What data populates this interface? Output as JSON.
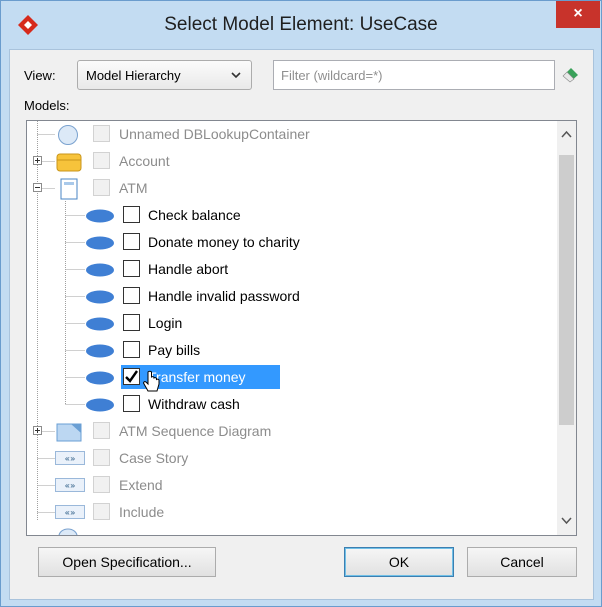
{
  "window": {
    "title": "Select Model Element: UseCase",
    "close_label": "×"
  },
  "view": {
    "label": "View:",
    "selected": "Model Hierarchy"
  },
  "filter": {
    "placeholder": "Filter (wildcard=*)",
    "value": ""
  },
  "models_label": "Models:",
  "tree": {
    "rows": [
      {
        "label": "Unnamed DBLookupContainer",
        "icon": "container-icon",
        "checkbox": "disabled",
        "expander": "",
        "level": 0
      },
      {
        "label": "Account",
        "icon": "class-icon",
        "checkbox": "disabled",
        "expander": "+",
        "level": 0
      },
      {
        "label": "ATM",
        "icon": "system-icon",
        "checkbox": "disabled",
        "expander": "-",
        "level": 0
      },
      {
        "label": "Check balance",
        "icon": "usecase-icon",
        "checkbox": "unchecked",
        "level": 1
      },
      {
        "label": "Donate money to charity",
        "icon": "usecase-icon",
        "checkbox": "unchecked",
        "level": 1
      },
      {
        "label": "Handle abort",
        "icon": "usecase-icon",
        "checkbox": "unchecked",
        "level": 1
      },
      {
        "label": "Handle invalid password",
        "icon": "usecase-icon",
        "checkbox": "unchecked",
        "level": 1
      },
      {
        "label": "Login",
        "icon": "usecase-icon",
        "checkbox": "unchecked",
        "level": 1
      },
      {
        "label": "Pay bills",
        "icon": "usecase-icon",
        "checkbox": "unchecked",
        "level": 1
      },
      {
        "label": "Transfer money",
        "icon": "usecase-icon",
        "checkbox": "checked",
        "level": 1,
        "selected": true
      },
      {
        "label": "Withdraw cash",
        "icon": "usecase-icon",
        "checkbox": "unchecked",
        "level": 1
      },
      {
        "label": "ATM Sequence Diagram",
        "icon": "diagram-icon",
        "checkbox": "disabled",
        "expander": "+",
        "level": 0
      },
      {
        "label": "Case Story",
        "icon": "stereotype-icon",
        "checkbox": "disabled",
        "level": 0
      },
      {
        "label": "Extend",
        "icon": "stereotype-icon",
        "checkbox": "disabled",
        "level": 0
      },
      {
        "label": "Include",
        "icon": "stereotype-icon",
        "checkbox": "disabled",
        "level": 0
      }
    ]
  },
  "buttons": {
    "open_spec": "Open Specification...",
    "ok": "OK",
    "cancel": "Cancel"
  },
  "colors": {
    "selection": "#3399ff",
    "titlebar": "#c3dcf2",
    "close": "#c8332b",
    "usecase": "#3f7fd4"
  }
}
